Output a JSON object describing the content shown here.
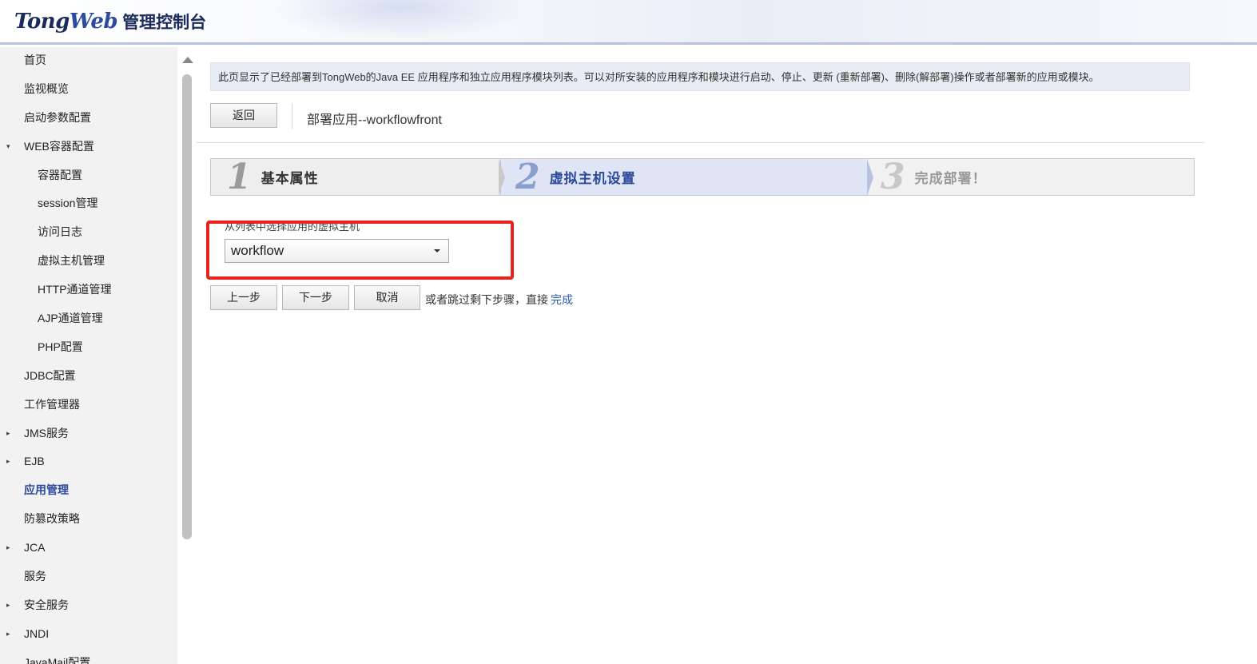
{
  "header": {
    "brand_tong": "Tong",
    "brand_web": "Web",
    "console_title": "管理控制台"
  },
  "sidebar": {
    "items": [
      {
        "label": "首页",
        "level": 0,
        "expander": ""
      },
      {
        "label": "监视概览",
        "level": 0,
        "expander": ""
      },
      {
        "label": "启动参数配置",
        "level": 0,
        "expander": ""
      },
      {
        "label": "WEB容器配置",
        "level": 0,
        "expander": "▾"
      },
      {
        "label": "容器配置",
        "level": 1,
        "expander": ""
      },
      {
        "label": "session管理",
        "level": 1,
        "expander": ""
      },
      {
        "label": "访问日志",
        "level": 1,
        "expander": ""
      },
      {
        "label": "虚拟主机管理",
        "level": 1,
        "expander": ""
      },
      {
        "label": "HTTP通道管理",
        "level": 1,
        "expander": ""
      },
      {
        "label": "AJP通道管理",
        "level": 1,
        "expander": ""
      },
      {
        "label": "PHP配置",
        "level": 1,
        "expander": ""
      },
      {
        "label": "JDBC配置",
        "level": 0,
        "expander": ""
      },
      {
        "label": "工作管理器",
        "level": 0,
        "expander": ""
      },
      {
        "label": "JMS服务",
        "level": 0,
        "expander": "▸"
      },
      {
        "label": "EJB",
        "level": 0,
        "expander": "▸"
      },
      {
        "label": "应用管理",
        "level": 0,
        "expander": "",
        "active": true
      },
      {
        "label": "防篡改策略",
        "level": 0,
        "expander": ""
      },
      {
        "label": "JCA",
        "level": 0,
        "expander": "▸"
      },
      {
        "label": "服务",
        "level": 0,
        "expander": ""
      },
      {
        "label": "安全服务",
        "level": 0,
        "expander": "▸"
      },
      {
        "label": "JNDI",
        "level": 0,
        "expander": "▸"
      },
      {
        "label": "JavaMail配置",
        "level": 0,
        "expander": ""
      }
    ]
  },
  "main": {
    "info_text": "此页显示了已经部署到TongWeb的Java EE 应用程序和独立应用程序模块列表。可以对所安装的应用程序和模块进行启动、停止、更新 (重新部署)、删除(解部署)操作或者部署新的应用或模块。",
    "back_button": "返回",
    "deploy_title": "部署应用--workflowfront",
    "steps": [
      {
        "num": "1",
        "label": "基本属性"
      },
      {
        "num": "2",
        "label": "虚拟主机设置"
      },
      {
        "num": "3",
        "label": "完成部署！"
      }
    ],
    "host_label": "从列表中选择应用的虚拟主机",
    "host_select_value": "workflow",
    "prev_button": "上一步",
    "next_button": "下一步",
    "cancel_button": "取消",
    "skip_text": "或者跳过剩下步骤，直接",
    "finish_link": "完成"
  }
}
